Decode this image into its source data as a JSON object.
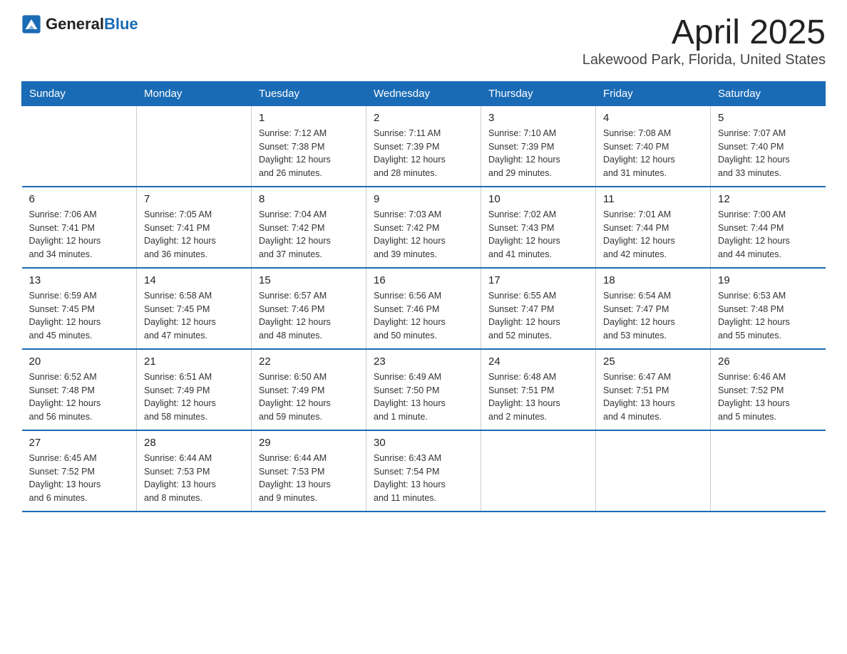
{
  "header": {
    "logo_general": "General",
    "logo_blue": "Blue",
    "title": "April 2025",
    "subtitle": "Lakewood Park, Florida, United States"
  },
  "weekdays": [
    "Sunday",
    "Monday",
    "Tuesday",
    "Wednesday",
    "Thursday",
    "Friday",
    "Saturday"
  ],
  "weeks": [
    [
      {
        "day": "",
        "info": ""
      },
      {
        "day": "",
        "info": ""
      },
      {
        "day": "1",
        "info": "Sunrise: 7:12 AM\nSunset: 7:38 PM\nDaylight: 12 hours\nand 26 minutes."
      },
      {
        "day": "2",
        "info": "Sunrise: 7:11 AM\nSunset: 7:39 PM\nDaylight: 12 hours\nand 28 minutes."
      },
      {
        "day": "3",
        "info": "Sunrise: 7:10 AM\nSunset: 7:39 PM\nDaylight: 12 hours\nand 29 minutes."
      },
      {
        "day": "4",
        "info": "Sunrise: 7:08 AM\nSunset: 7:40 PM\nDaylight: 12 hours\nand 31 minutes."
      },
      {
        "day": "5",
        "info": "Sunrise: 7:07 AM\nSunset: 7:40 PM\nDaylight: 12 hours\nand 33 minutes."
      }
    ],
    [
      {
        "day": "6",
        "info": "Sunrise: 7:06 AM\nSunset: 7:41 PM\nDaylight: 12 hours\nand 34 minutes."
      },
      {
        "day": "7",
        "info": "Sunrise: 7:05 AM\nSunset: 7:41 PM\nDaylight: 12 hours\nand 36 minutes."
      },
      {
        "day": "8",
        "info": "Sunrise: 7:04 AM\nSunset: 7:42 PM\nDaylight: 12 hours\nand 37 minutes."
      },
      {
        "day": "9",
        "info": "Sunrise: 7:03 AM\nSunset: 7:42 PM\nDaylight: 12 hours\nand 39 minutes."
      },
      {
        "day": "10",
        "info": "Sunrise: 7:02 AM\nSunset: 7:43 PM\nDaylight: 12 hours\nand 41 minutes."
      },
      {
        "day": "11",
        "info": "Sunrise: 7:01 AM\nSunset: 7:44 PM\nDaylight: 12 hours\nand 42 minutes."
      },
      {
        "day": "12",
        "info": "Sunrise: 7:00 AM\nSunset: 7:44 PM\nDaylight: 12 hours\nand 44 minutes."
      }
    ],
    [
      {
        "day": "13",
        "info": "Sunrise: 6:59 AM\nSunset: 7:45 PM\nDaylight: 12 hours\nand 45 minutes."
      },
      {
        "day": "14",
        "info": "Sunrise: 6:58 AM\nSunset: 7:45 PM\nDaylight: 12 hours\nand 47 minutes."
      },
      {
        "day": "15",
        "info": "Sunrise: 6:57 AM\nSunset: 7:46 PM\nDaylight: 12 hours\nand 48 minutes."
      },
      {
        "day": "16",
        "info": "Sunrise: 6:56 AM\nSunset: 7:46 PM\nDaylight: 12 hours\nand 50 minutes."
      },
      {
        "day": "17",
        "info": "Sunrise: 6:55 AM\nSunset: 7:47 PM\nDaylight: 12 hours\nand 52 minutes."
      },
      {
        "day": "18",
        "info": "Sunrise: 6:54 AM\nSunset: 7:47 PM\nDaylight: 12 hours\nand 53 minutes."
      },
      {
        "day": "19",
        "info": "Sunrise: 6:53 AM\nSunset: 7:48 PM\nDaylight: 12 hours\nand 55 minutes."
      }
    ],
    [
      {
        "day": "20",
        "info": "Sunrise: 6:52 AM\nSunset: 7:48 PM\nDaylight: 12 hours\nand 56 minutes."
      },
      {
        "day": "21",
        "info": "Sunrise: 6:51 AM\nSunset: 7:49 PM\nDaylight: 12 hours\nand 58 minutes."
      },
      {
        "day": "22",
        "info": "Sunrise: 6:50 AM\nSunset: 7:49 PM\nDaylight: 12 hours\nand 59 minutes."
      },
      {
        "day": "23",
        "info": "Sunrise: 6:49 AM\nSunset: 7:50 PM\nDaylight: 13 hours\nand 1 minute."
      },
      {
        "day": "24",
        "info": "Sunrise: 6:48 AM\nSunset: 7:51 PM\nDaylight: 13 hours\nand 2 minutes."
      },
      {
        "day": "25",
        "info": "Sunrise: 6:47 AM\nSunset: 7:51 PM\nDaylight: 13 hours\nand 4 minutes."
      },
      {
        "day": "26",
        "info": "Sunrise: 6:46 AM\nSunset: 7:52 PM\nDaylight: 13 hours\nand 5 minutes."
      }
    ],
    [
      {
        "day": "27",
        "info": "Sunrise: 6:45 AM\nSunset: 7:52 PM\nDaylight: 13 hours\nand 6 minutes."
      },
      {
        "day": "28",
        "info": "Sunrise: 6:44 AM\nSunset: 7:53 PM\nDaylight: 13 hours\nand 8 minutes."
      },
      {
        "day": "29",
        "info": "Sunrise: 6:44 AM\nSunset: 7:53 PM\nDaylight: 13 hours\nand 9 minutes."
      },
      {
        "day": "30",
        "info": "Sunrise: 6:43 AM\nSunset: 7:54 PM\nDaylight: 13 hours\nand 11 minutes."
      },
      {
        "day": "",
        "info": ""
      },
      {
        "day": "",
        "info": ""
      },
      {
        "day": "",
        "info": ""
      }
    ]
  ]
}
